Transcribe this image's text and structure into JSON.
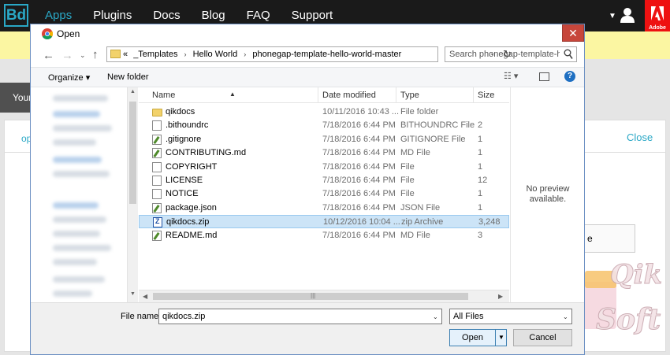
{
  "site": {
    "logo": "Bd",
    "nav": [
      "Apps",
      "Plugins",
      "Docs",
      "Blog",
      "FAQ",
      "Support"
    ],
    "active_nav": "Apps",
    "adobe_label": "Adobe",
    "your_tab": "Your",
    "op_link": "op",
    "close_link": "Close",
    "right_box_text": "e",
    "watermark_text": [
      "Qik",
      "Soft"
    ],
    "colors": {
      "accent": "#2aa8c6",
      "topbar": "#1a1a1a",
      "banner": "#fbf6a2",
      "adobe": "#ee1111"
    }
  },
  "dialog": {
    "title": "Open",
    "close_glyph": "✕",
    "address": {
      "prefix": "«",
      "segments": [
        "_Templates",
        "Hello World",
        "phonegap-template-hello-world-master"
      ],
      "separator": "›"
    },
    "search_placeholder": "Search phonegap-template-h...",
    "toolbar": {
      "organize": "Organize ▾",
      "new_folder": "New folder",
      "views": "☷ ▾",
      "help": "?"
    },
    "columns": [
      "Name",
      "Date modified",
      "Type",
      "Size"
    ],
    "files": [
      {
        "icon": "folder",
        "name": "qikdocs",
        "date": "10/11/2016 10:43 ...",
        "type": "File folder",
        "size": ""
      },
      {
        "icon": "doc",
        "name": ".bithoundrc",
        "date": "7/18/2016 6:44 PM",
        "type": "BITHOUNDRC File",
        "size": "2"
      },
      {
        "icon": "edit",
        "name": ".gitignore",
        "date": "7/18/2016 6:44 PM",
        "type": "GITIGNORE File",
        "size": "1"
      },
      {
        "icon": "edit",
        "name": "CONTRIBUTING.md",
        "date": "7/18/2016 6:44 PM",
        "type": "MD File",
        "size": "1"
      },
      {
        "icon": "doc",
        "name": "COPYRIGHT",
        "date": "7/18/2016 6:44 PM",
        "type": "File",
        "size": "1"
      },
      {
        "icon": "doc",
        "name": "LICENSE",
        "date": "7/18/2016 6:44 PM",
        "type": "File",
        "size": "12"
      },
      {
        "icon": "doc",
        "name": "NOTICE",
        "date": "7/18/2016 6:44 PM",
        "type": "File",
        "size": "1"
      },
      {
        "icon": "edit",
        "name": "package.json",
        "date": "7/18/2016 6:44 PM",
        "type": "JSON File",
        "size": "1"
      },
      {
        "icon": "zip",
        "name": "qikdocs.zip",
        "date": "10/12/2016 10:04 ...",
        "type": "zip Archive",
        "size": "3,248",
        "selected": true
      },
      {
        "icon": "edit",
        "name": "README.md",
        "date": "7/18/2016 6:44 PM",
        "type": "MD File",
        "size": "3"
      }
    ],
    "preview_text": [
      "No preview",
      "available."
    ],
    "file_name_label": "File name:",
    "file_name_value": "qikdocs.zip",
    "file_type_value": "All Files",
    "open_button": "Open",
    "cancel_button": "Cancel"
  }
}
